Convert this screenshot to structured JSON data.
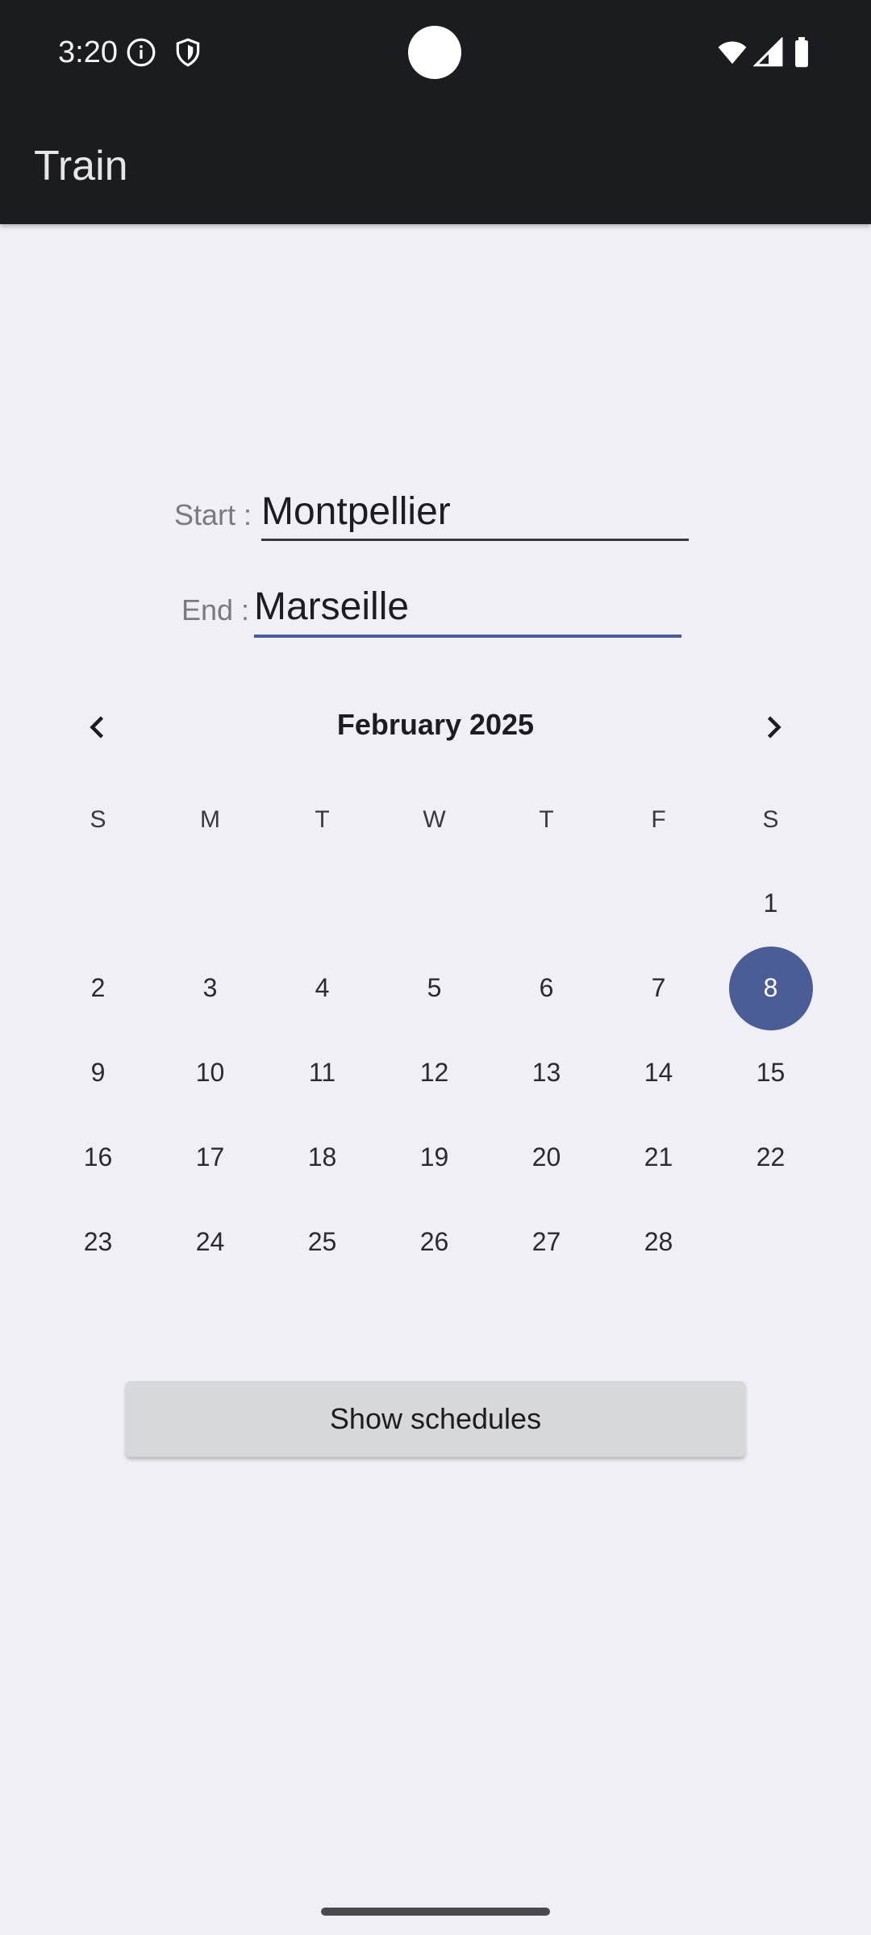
{
  "status_bar": {
    "time": "3:20",
    "icons": [
      "info-icon",
      "shield-icon",
      "wifi-icon",
      "signal-icon",
      "battery-icon"
    ]
  },
  "app_bar": {
    "title": "Train"
  },
  "form": {
    "start": {
      "label": "Start :",
      "value": "Montpellier"
    },
    "end": {
      "label": "End :",
      "value": "Marseille"
    }
  },
  "calendar": {
    "month_title": "February 2025",
    "weekdays": [
      "S",
      "M",
      "T",
      "W",
      "T",
      "F",
      "S"
    ],
    "selected_day": "8",
    "weeks": [
      [
        "",
        "",
        "",
        "",
        "",
        "",
        "1"
      ],
      [
        "2",
        "3",
        "4",
        "5",
        "6",
        "7",
        "8"
      ],
      [
        "9",
        "10",
        "11",
        "12",
        "13",
        "14",
        "15"
      ],
      [
        "16",
        "17",
        "18",
        "19",
        "20",
        "21",
        "22"
      ],
      [
        "23",
        "24",
        "25",
        "26",
        "27",
        "28",
        ""
      ]
    ]
  },
  "actions": {
    "show_schedules": "Show schedules"
  },
  "colors": {
    "accent": "#4a5d96",
    "app_bar": "#1b1c20",
    "background": "#f0eff6",
    "button": "#d7d8da"
  }
}
